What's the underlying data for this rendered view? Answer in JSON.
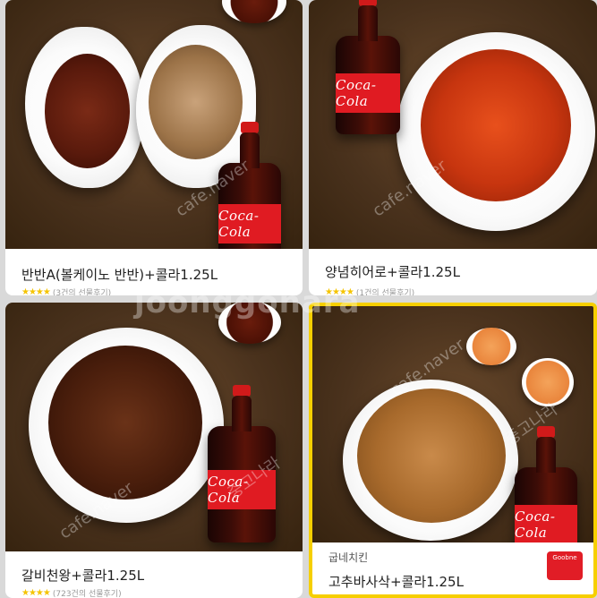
{
  "cards": [
    {
      "title": "반반A(볼케이노 반반)+콜라1.25L",
      "stars": "★★★★",
      "review": "(3건의 선물후기)"
    },
    {
      "title": "양념히어로+콜라1.25L",
      "stars": "★★★★",
      "review": "(1건의 선물후기)"
    },
    {
      "title": "갈비천왕+콜라1.25L",
      "stars": "★★★★",
      "review": "(723건의 선물후기)"
    },
    {
      "brand": "굽네치킨",
      "title": "고추바사삭+콜라1.25L",
      "brand_logo_text": "Goobne"
    }
  ],
  "bottle_label": "Coca-Cola",
  "watermarks": [
    "cafe.naver",
    "cafe.naver",
    "cafe.naver",
    "중고나라",
    "중고나라",
    "cafe.naver"
  ],
  "watermark_big": "joonggonara",
  "colors": {
    "highlight_border": "#f6cf00",
    "star": "#f5c400",
    "background": "#d9d9d9"
  }
}
